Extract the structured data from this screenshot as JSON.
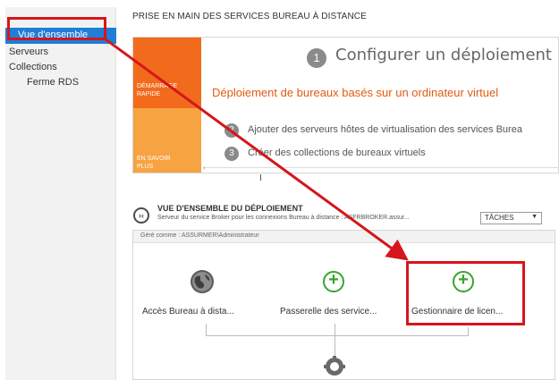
{
  "sidebar": {
    "items": [
      {
        "label": "Vue d'ensemble"
      },
      {
        "label": "Serveurs"
      },
      {
        "label": "Collections"
      },
      {
        "label": "Ferme RDS"
      }
    ]
  },
  "main": {
    "title": "PRISE EN MAIN DES SERVICES BUREAU À DISTANCE"
  },
  "quickstart": {
    "tile1": [
      "DÉMARRAGE",
      "RAPIDE"
    ],
    "tile2": [
      "EN SAVOIR",
      "PLUS"
    ],
    "step1_number": "1",
    "step1_text": "Configurer un déploiement po",
    "heading": "Déploiement de bureaux basés sur un ordinateur virtuel",
    "step2_number": "2",
    "step2_text": "Ajouter des serveurs hôtes de virtualisation des services Burea",
    "step3_number": "3",
    "step3_text": "Créer des collections de bureaux virtuels"
  },
  "deployment": {
    "title": "VUE D'ENSEMBLE DU DÉPLOIEMENT",
    "subtitle": "Serveur du service Broker pour les connexions Bureau à distance : ASFRBROKER.assur...",
    "tasks_label": "TÂCHES",
    "managed_as": "Géré comme : ASSURMER\\Administrateur",
    "nodes": [
      {
        "label": "Accès Bureau à dista..."
      },
      {
        "label": "Passerelle des service..."
      },
      {
        "label": "Gestionnaire de licen..."
      }
    ]
  },
  "colors": {
    "accent": "#1e7ed8",
    "highlight_red": "#d5161b",
    "orange": "#f26a1b",
    "light_orange": "#f7a341",
    "green": "#36a52d"
  }
}
